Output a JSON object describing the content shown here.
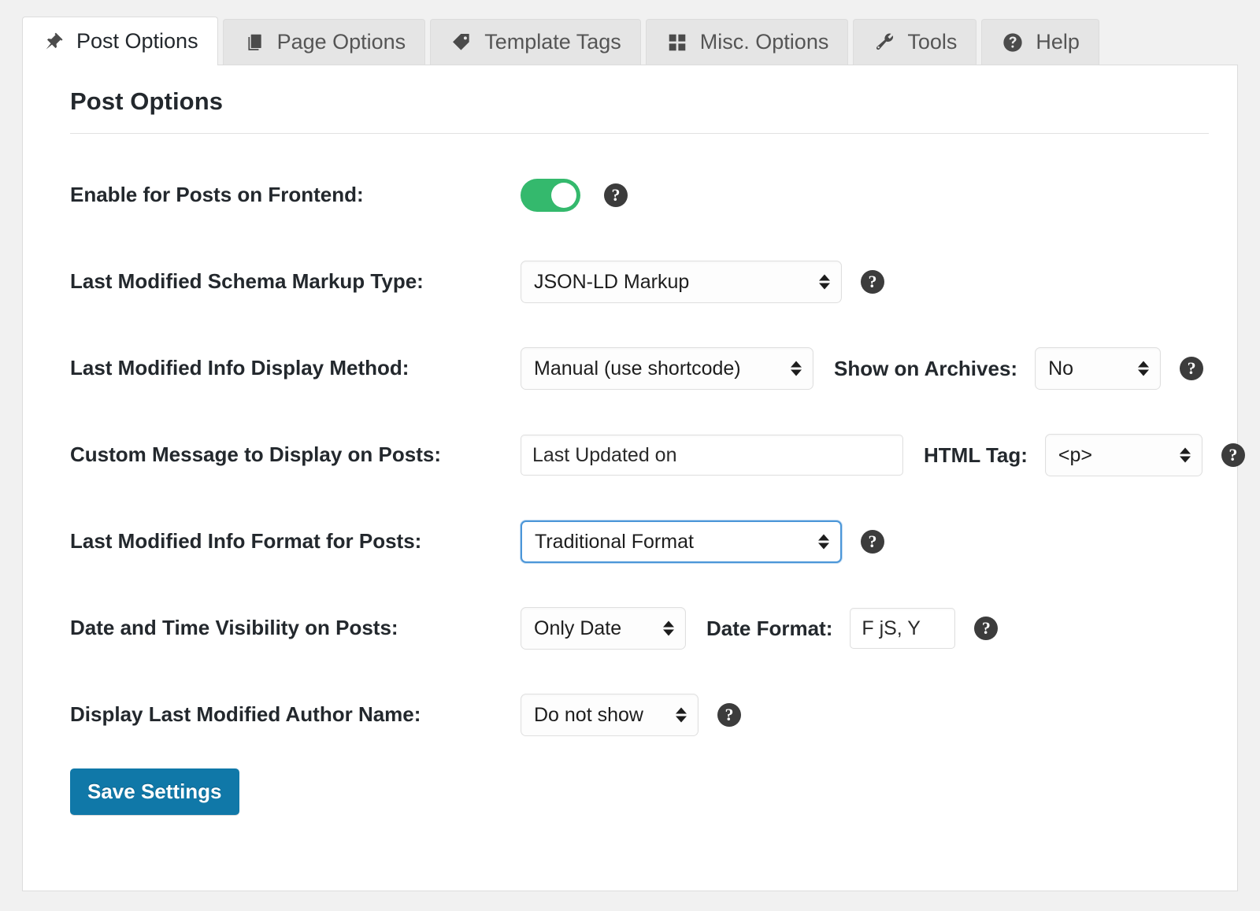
{
  "tabs": [
    {
      "label": "Post Options",
      "icon": "pin-icon",
      "active": true
    },
    {
      "label": "Page Options",
      "icon": "pages-icon",
      "active": false
    },
    {
      "label": "Template Tags",
      "icon": "tag-icon",
      "active": false
    },
    {
      "label": "Misc. Options",
      "icon": "grid-icon",
      "active": false
    },
    {
      "label": "Tools",
      "icon": "wrench-icon",
      "active": false
    },
    {
      "label": "Help",
      "icon": "help-circle-icon",
      "active": false
    }
  ],
  "panel": {
    "title": "Post Options"
  },
  "form": {
    "enable_frontend": {
      "label": "Enable for Posts on Frontend:",
      "toggle_state": "on"
    },
    "schema_markup": {
      "label": "Last Modified Schema Markup Type:",
      "value": "JSON-LD Markup"
    },
    "display_method": {
      "label": "Last Modified Info Display Method:",
      "value": "Manual (use shortcode)",
      "secondary_label": "Show on Archives:",
      "secondary_value": "No"
    },
    "custom_message": {
      "label": "Custom Message to Display on Posts:",
      "value": "Last Updated on",
      "secondary_label": "HTML Tag:",
      "secondary_value": "<p>"
    },
    "info_format": {
      "label": "Last Modified Info Format for Posts:",
      "value": "Traditional Format",
      "focused": true
    },
    "date_time_visibility": {
      "label": "Date and Time Visibility on Posts:",
      "value": "Only Date",
      "secondary_label": "Date Format:",
      "secondary_value": "F jS, Y"
    },
    "author_name": {
      "label": "Display Last Modified Author Name:",
      "value": "Do not show"
    }
  },
  "actions": {
    "save_label": "Save Settings"
  },
  "help_glyph": "?",
  "colors": {
    "toggle_on": "#34b96d",
    "save_button": "#1078a8",
    "focus_border": "#4b96d8",
    "help_icon": "#3c3c3c",
    "page_background": "#f1f1f1"
  }
}
